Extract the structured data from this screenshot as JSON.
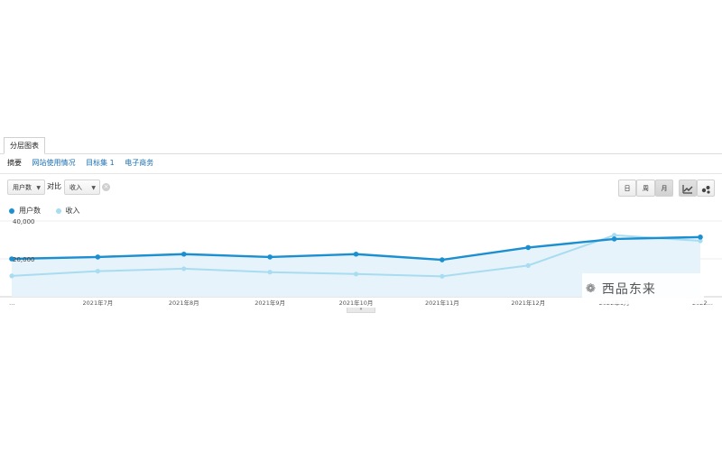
{
  "tabs": {
    "active_label": "分层图表"
  },
  "subnav": {
    "items": [
      "摘要",
      "网站使用情况",
      "目标集 1",
      "电子商务"
    ]
  },
  "controls": {
    "metric1": "用户数",
    "vs_label": "对比",
    "metric2": "收入",
    "interval_buttons": [
      "日",
      "周",
      "月"
    ],
    "active_interval": "月",
    "remove_symbol": "×",
    "caret": "▼"
  },
  "legend": [
    {
      "name": "用户数",
      "color": "#1b8fd0"
    },
    {
      "name": "收入",
      "color": "#a8dcf0"
    }
  ],
  "chart_data": {
    "type": "line",
    "categories": [
      "…",
      "2021年7月",
      "2021年8月",
      "2021年9月",
      "2021年10月",
      "2021年11月",
      "2021年12月",
      "2022年1月",
      "2022…"
    ],
    "series": [
      {
        "name": "用户数",
        "values": [
          20000,
          21000,
          22500,
          21000,
          22500,
          19500,
          26000,
          30500,
          31500
        ]
      },
      {
        "name": "收入",
        "values": [
          11000,
          13500,
          14800,
          13000,
          12000,
          10800,
          16500,
          32500,
          29500
        ]
      }
    ],
    "y_tick_labels": [
      "40,000",
      "20,000"
    ],
    "ylim": [
      0,
      40000
    ],
    "grid": true,
    "colors": {
      "users": "#1b8fd0",
      "revenue": "#a8dcf0",
      "area": "#e6f3fb"
    }
  },
  "watermark": {
    "text": "西品东来",
    "icon": "wechat-icon",
    "symbol": "❁"
  },
  "scroll_handle_symbol": "▾"
}
